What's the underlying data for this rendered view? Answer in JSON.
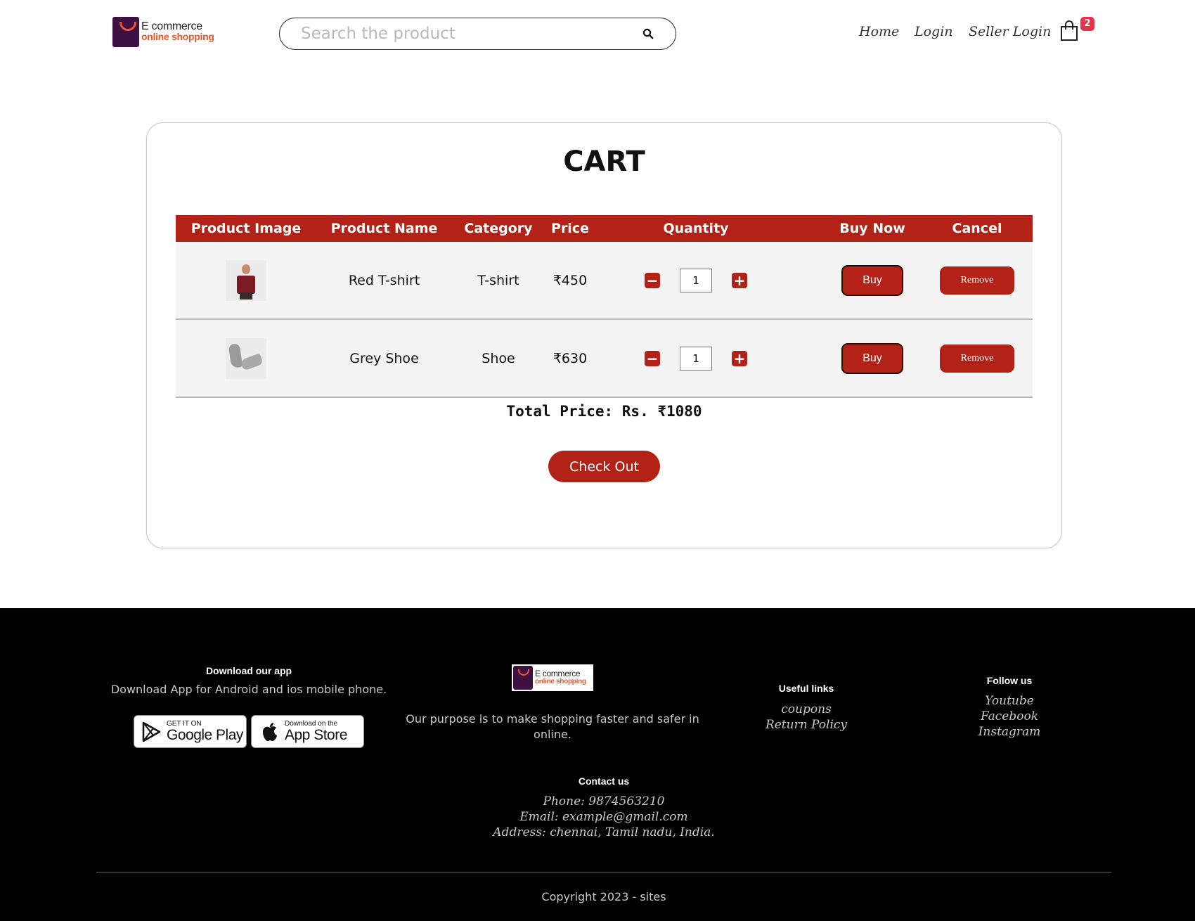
{
  "header": {
    "logo": {
      "line1": "E commerce",
      "line2": "online shopping"
    },
    "search": {
      "placeholder": "Search the product"
    },
    "nav": {
      "home": "Home",
      "login": "Login",
      "seller_login": "Seller Login"
    },
    "cart_count": "2"
  },
  "cart": {
    "title": "CART",
    "columns": [
      "Product Image",
      "Product Name",
      "Category",
      "Price",
      "Quantity",
      "Buy Now",
      "Cancel"
    ],
    "items": [
      {
        "image": "red-tshirt-image",
        "name": "Red T-shirt",
        "category": "T-shirt",
        "price": "₹450",
        "quantity": "1",
        "buy_label": "Buy",
        "remove_label": "Remove"
      },
      {
        "image": "grey-shoe-image",
        "name": "Grey Shoe",
        "category": "Shoe",
        "price": "₹630",
        "quantity": "1",
        "buy_label": "Buy",
        "remove_label": "Remove"
      }
    ],
    "total": "Total Price: Rs. ₹1080",
    "checkout_label": "Check Out"
  },
  "footer": {
    "download": {
      "heading": "Download our app",
      "text": "Download App for Android and ios mobile phone.",
      "google_play": {
        "small": "GET IT ON",
        "big": "Google Play"
      },
      "app_store": {
        "small": "Download on the",
        "big": "App Store"
      }
    },
    "logo": {
      "line1": "E commerce",
      "line2": "online shopping"
    },
    "purpose": {
      "line1": "Our purpose is to make shopping faster and safer in",
      "line2": "online."
    },
    "useful_links": {
      "heading": "Useful links",
      "items": [
        "coupons",
        "Return Policy"
      ]
    },
    "follow_us": {
      "heading": "Follow us",
      "items": [
        "Youtube",
        "Facebook",
        "Instagram"
      ]
    },
    "contact": {
      "heading": "Contact us",
      "phone": "Phone: 9874563210",
      "email": "Email: example@gmail.com",
      "address": "Address: chennai, Tamil nadu, India."
    },
    "copyright": "Copyright 2023 - sites"
  },
  "colors": {
    "brand_red": "#b22216",
    "badge_red": "#e63246",
    "footer_bg": "#000000",
    "logo_purple": "#3d1243",
    "logo_orange": "#e8582a"
  },
  "icons": {
    "search": "search-icon",
    "cart": "shopping-bag-icon",
    "minus": "minus-square-icon",
    "plus": "plus-square-icon"
  }
}
